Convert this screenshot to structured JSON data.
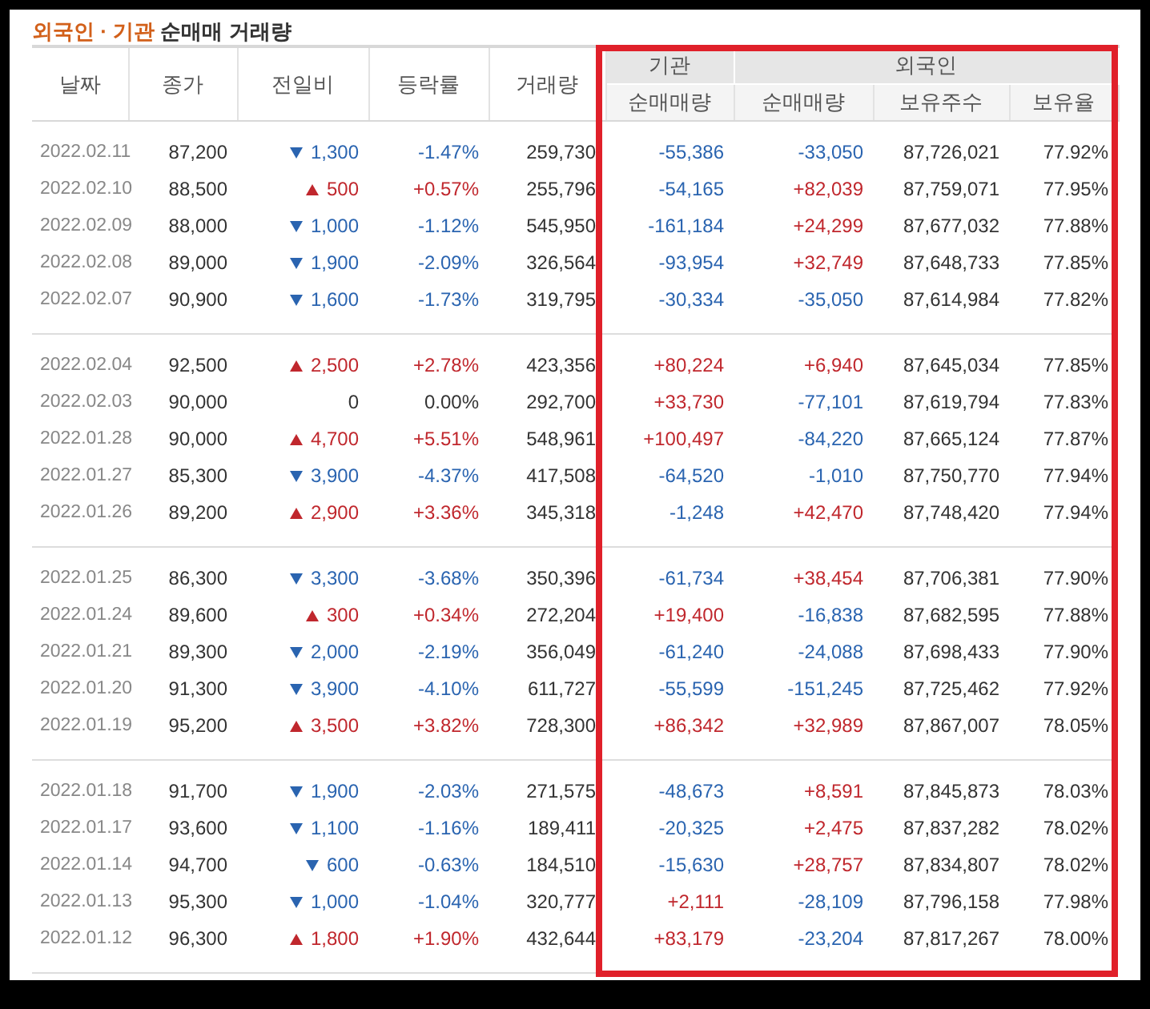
{
  "title": {
    "highlight": "외국인 · 기관",
    "rest": "순매매 거래량"
  },
  "columns": [
    "날짜",
    "종가",
    "전일비",
    "등락률",
    "거래량"
  ],
  "groups": [
    {
      "label": "기관",
      "sub": [
        "순매매량"
      ]
    },
    {
      "label": "외국인",
      "sub": [
        "순매매량",
        "보유주수",
        "보유율"
      ]
    }
  ],
  "blocks": [
    {
      "rows": [
        {
          "date": "2022.02.11",
          "close": "87,200",
          "up": false,
          "down": true,
          "change": "1,300",
          "rate": "-1.47%",
          "volume": "259,730",
          "inst": "-55,386",
          "inst_up": false,
          "foreign": "-33,050",
          "foreign_up": false,
          "holdings": "87,726,021",
          "ratio": "77.92%"
        },
        {
          "date": "2022.02.10",
          "close": "88,500",
          "up": true,
          "down": false,
          "change": "500",
          "rate": "+0.57%",
          "volume": "255,796",
          "inst": "-54,165",
          "inst_up": false,
          "foreign": "+82,039",
          "foreign_up": true,
          "holdings": "87,759,071",
          "ratio": "77.95%"
        },
        {
          "date": "2022.02.09",
          "close": "88,000",
          "up": false,
          "down": true,
          "change": "1,000",
          "rate": "-1.12%",
          "volume": "545,950",
          "inst": "-161,184",
          "inst_up": false,
          "foreign": "+24,299",
          "foreign_up": true,
          "holdings": "87,677,032",
          "ratio": "77.88%"
        },
        {
          "date": "2022.02.08",
          "close": "89,000",
          "up": false,
          "down": true,
          "change": "1,900",
          "rate": "-2.09%",
          "volume": "326,564",
          "inst": "-93,954",
          "inst_up": false,
          "foreign": "+32,749",
          "foreign_up": true,
          "holdings": "87,648,733",
          "ratio": "77.85%"
        },
        {
          "date": "2022.02.07",
          "close": "90,900",
          "up": false,
          "down": true,
          "change": "1,600",
          "rate": "-1.73%",
          "volume": "319,795",
          "inst": "-30,334",
          "inst_up": false,
          "foreign": "-35,050",
          "foreign_up": false,
          "holdings": "87,614,984",
          "ratio": "77.82%"
        }
      ]
    },
    {
      "rows": [
        {
          "date": "2022.02.04",
          "close": "92,500",
          "up": true,
          "down": false,
          "change": "2,500",
          "rate": "+2.78%",
          "volume": "423,356",
          "inst": "+80,224",
          "inst_up": true,
          "foreign": "+6,940",
          "foreign_up": true,
          "holdings": "87,645,034",
          "ratio": "77.85%"
        },
        {
          "date": "2022.02.03",
          "close": "90,000",
          "up": false,
          "down": false,
          "change": "0",
          "rate": "0.00%",
          "volume": "292,700",
          "inst": "+33,730",
          "inst_up": true,
          "foreign": "-77,101",
          "foreign_up": false,
          "holdings": "87,619,794",
          "ratio": "77.83%"
        },
        {
          "date": "2022.01.28",
          "close": "90,000",
          "up": true,
          "down": false,
          "change": "4,700",
          "rate": "+5.51%",
          "volume": "548,961",
          "inst": "+100,497",
          "inst_up": true,
          "foreign": "-84,220",
          "foreign_up": false,
          "holdings": "87,665,124",
          "ratio": "77.87%"
        },
        {
          "date": "2022.01.27",
          "close": "85,300",
          "up": false,
          "down": true,
          "change": "3,900",
          "rate": "-4.37%",
          "volume": "417,508",
          "inst": "-64,520",
          "inst_up": false,
          "foreign": "-1,010",
          "foreign_up": false,
          "holdings": "87,750,770",
          "ratio": "77.94%"
        },
        {
          "date": "2022.01.26",
          "close": "89,200",
          "up": true,
          "down": false,
          "change": "2,900",
          "rate": "+3.36%",
          "volume": "345,318",
          "inst": "-1,248",
          "inst_up": false,
          "foreign": "+42,470",
          "foreign_up": true,
          "holdings": "87,748,420",
          "ratio": "77.94%"
        }
      ]
    },
    {
      "rows": [
        {
          "date": "2022.01.25",
          "close": "86,300",
          "up": false,
          "down": true,
          "change": "3,300",
          "rate": "-3.68%",
          "volume": "350,396",
          "inst": "-61,734",
          "inst_up": false,
          "foreign": "+38,454",
          "foreign_up": true,
          "holdings": "87,706,381",
          "ratio": "77.90%"
        },
        {
          "date": "2022.01.24",
          "close": "89,600",
          "up": true,
          "down": false,
          "change": "300",
          "rate": "+0.34%",
          "volume": "272,204",
          "inst": "+19,400",
          "inst_up": true,
          "foreign": "-16,838",
          "foreign_up": false,
          "holdings": "87,682,595",
          "ratio": "77.88%"
        },
        {
          "date": "2022.01.21",
          "close": "89,300",
          "up": false,
          "down": true,
          "change": "2,000",
          "rate": "-2.19%",
          "volume": "356,049",
          "inst": "-61,240",
          "inst_up": false,
          "foreign": "-24,088",
          "foreign_up": false,
          "holdings": "87,698,433",
          "ratio": "77.90%"
        },
        {
          "date": "2022.01.20",
          "close": "91,300",
          "up": false,
          "down": true,
          "change": "3,900",
          "rate": "-4.10%",
          "volume": "611,727",
          "inst": "-55,599",
          "inst_up": false,
          "foreign": "-151,245",
          "foreign_up": false,
          "holdings": "87,725,462",
          "ratio": "77.92%"
        },
        {
          "date": "2022.01.19",
          "close": "95,200",
          "up": true,
          "down": false,
          "change": "3,500",
          "rate": "+3.82%",
          "volume": "728,300",
          "inst": "+86,342",
          "inst_up": true,
          "foreign": "+32,989",
          "foreign_up": true,
          "holdings": "87,867,007",
          "ratio": "78.05%"
        }
      ]
    },
    {
      "rows": [
        {
          "date": "2022.01.18",
          "close": "91,700",
          "up": false,
          "down": true,
          "change": "1,900",
          "rate": "-2.03%",
          "volume": "271,575",
          "inst": "-48,673",
          "inst_up": false,
          "foreign": "+8,591",
          "foreign_up": true,
          "holdings": "87,845,873",
          "ratio": "78.03%"
        },
        {
          "date": "2022.01.17",
          "close": "93,600",
          "up": false,
          "down": true,
          "change": "1,100",
          "rate": "-1.16%",
          "volume": "189,411",
          "inst": "-20,325",
          "inst_up": false,
          "foreign": "+2,475",
          "foreign_up": true,
          "holdings": "87,837,282",
          "ratio": "78.02%"
        },
        {
          "date": "2022.01.14",
          "close": "94,700",
          "up": false,
          "down": true,
          "change": "600",
          "rate": "-0.63%",
          "volume": "184,510",
          "inst": "-15,630",
          "inst_up": false,
          "foreign": "+28,757",
          "foreign_up": true,
          "holdings": "87,834,807",
          "ratio": "78.02%"
        },
        {
          "date": "2022.01.13",
          "close": "95,300",
          "up": false,
          "down": true,
          "change": "1,000",
          "rate": "-1.04%",
          "volume": "320,777",
          "inst": "+2,111",
          "inst_up": true,
          "foreign": "-28,109",
          "foreign_up": false,
          "holdings": "87,796,158",
          "ratio": "77.98%"
        },
        {
          "date": "2022.01.12",
          "close": "96,300",
          "up": true,
          "down": false,
          "change": "1,800",
          "rate": "+1.90%",
          "volume": "432,644",
          "inst": "+83,179",
          "inst_up": true,
          "foreign": "-23,204",
          "foreign_up": false,
          "holdings": "87,817,267",
          "ratio": "78.00%"
        }
      ]
    }
  ]
}
